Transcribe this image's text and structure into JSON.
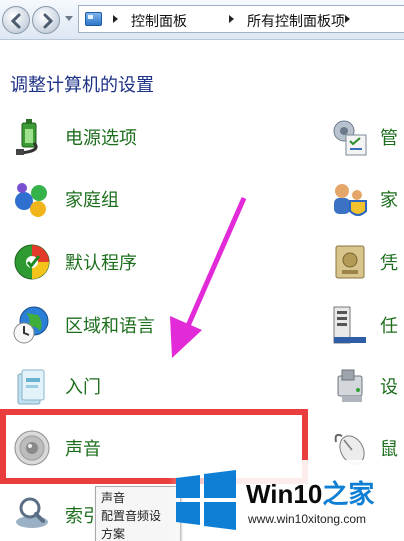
{
  "address_bar": {
    "breadcrumbs": [
      "控制面板",
      "所有控制面板项"
    ]
  },
  "header": {
    "title": "调整计算机的设置"
  },
  "left_items": [
    {
      "label": "电源选项",
      "icon": "power-options-icon"
    },
    {
      "label": "家庭组",
      "icon": "homegroup-icon"
    },
    {
      "label": "默认程序",
      "icon": "default-programs-icon"
    },
    {
      "label": "区域和语言",
      "icon": "region-language-icon"
    },
    {
      "label": "入门",
      "icon": "getting-started-icon"
    },
    {
      "label": "声音",
      "icon": "sound-icon"
    },
    {
      "label": "索引",
      "icon": "indexing-options-icon"
    }
  ],
  "right_items": [
    {
      "label": "管",
      "icon": "admin-tools-icon"
    },
    {
      "label": "家",
      "icon": "parental-controls-icon"
    },
    {
      "label": "凭",
      "icon": "credential-manager-icon"
    },
    {
      "label": "任",
      "icon": "taskbar-icon"
    },
    {
      "label": "设",
      "icon": "device-manager-icon"
    },
    {
      "label": "鼠",
      "icon": "mouse-icon"
    }
  ],
  "tooltip": {
    "lines": [
      "声音",
      "配置音频设",
      "方案"
    ]
  },
  "watermark": {
    "brand_main": "Win10",
    "brand_accent": "之家",
    "url": "www.win10xitong.com"
  },
  "colors": {
    "highlight": "#ea3d3d",
    "arrow": "#e22ad8",
    "link_green": "#1d6e1d",
    "header_blue": "#1e3287",
    "win_blue": "#0e7fd4"
  }
}
